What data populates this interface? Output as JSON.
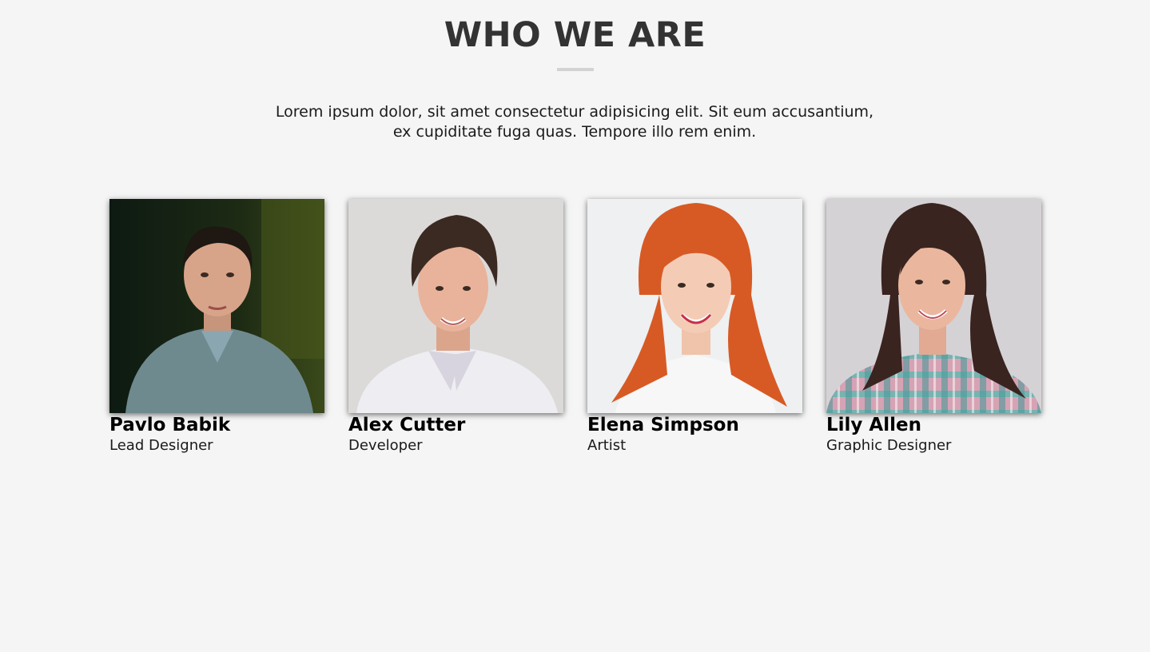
{
  "section": {
    "title": "WHO WE ARE",
    "intro_line_1": "Lorem ipsum dolor, sit amet consectetur adipisicing elit. Sit eum accusantium,",
    "intro_line_2": "ex cupiditate fuga quas. Tempore illo rem enim."
  },
  "colors": {
    "background": "#f5f5f5",
    "title": "#333333",
    "divider": "#d3d3d3"
  },
  "team": [
    {
      "name": "Pavlo Babik",
      "role": "Lead Designer",
      "photo": "portrait-photo"
    },
    {
      "name": "Alex Cutter",
      "role": "Developer",
      "photo": "portrait-photo"
    },
    {
      "name": "Elena Simpson",
      "role": "Artist",
      "photo": "portrait-photo"
    },
    {
      "name": "Lily Allen",
      "role": "Graphic Designer",
      "photo": "portrait-photo"
    }
  ]
}
